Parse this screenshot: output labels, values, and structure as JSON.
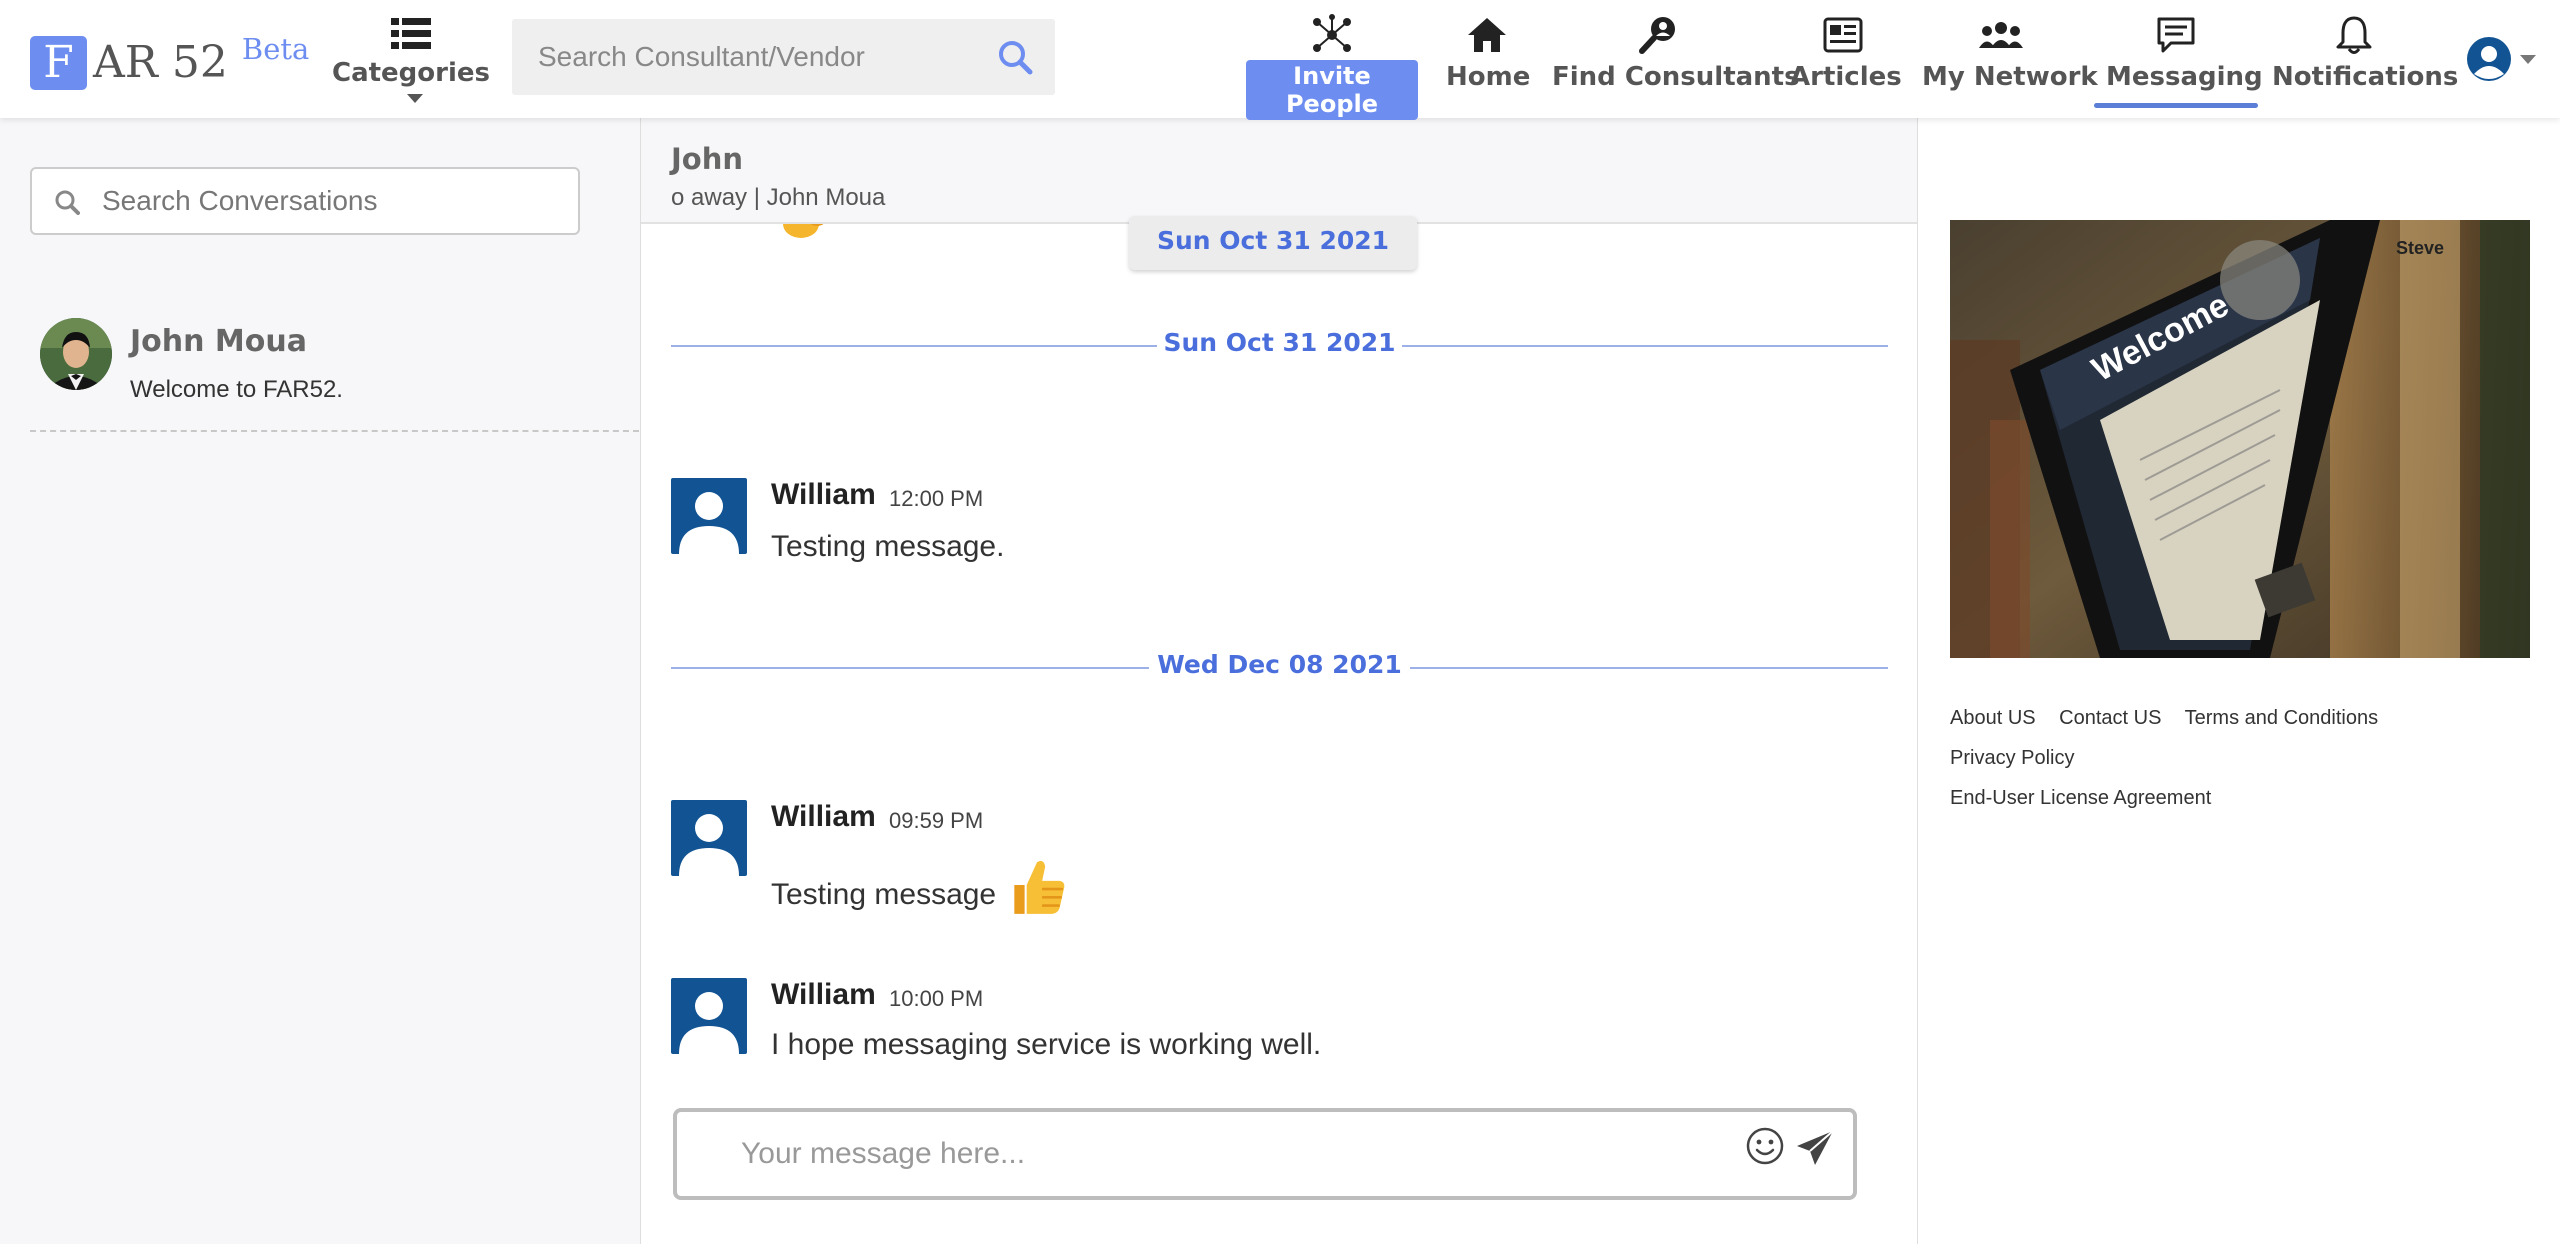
{
  "brand": {
    "logo_letter": "F",
    "logo_text": "AR 52",
    "beta": "Beta",
    "accent": "#6d8df0"
  },
  "nav": {
    "categories_label": "Categories",
    "search_placeholder": "Search Consultant/Vendor",
    "invite_label": "Invite People",
    "home_label": "Home",
    "find_label": "Find Consultants",
    "articles_label": "Articles",
    "network_label": "My Network",
    "messaging_label": "Messaging",
    "notifications_label": "Notifications",
    "active": "Messaging"
  },
  "sidebar": {
    "search_placeholder": "Search Conversations",
    "conversations": [
      {
        "name": "John Moua",
        "preview": "Welcome to FAR52."
      }
    ]
  },
  "chat": {
    "title": "John",
    "subtitle": "o away | John Moua",
    "sticky_date": "Sun Oct 31 2021",
    "date_separators": [
      "Sun Oct 31 2021",
      "Wed Dec 08 2021"
    ],
    "messages": [
      {
        "author": "William",
        "time": "12:00 PM",
        "text": "Testing message."
      },
      {
        "author": "William",
        "time": "09:59 PM",
        "text": "Testing message",
        "emoji": "thumbs-up"
      },
      {
        "author": "William",
        "time": "10:00 PM",
        "text": "I hope messaging service is working well."
      }
    ],
    "compose_placeholder": "Your message here..."
  },
  "right": {
    "ad_text": {
      "welcome": "Welcome",
      "name": "Steve"
    },
    "footer_links": [
      "About US",
      "Contact US",
      "Terms and Conditions",
      "Privacy Policy",
      "End-User License Agreement"
    ]
  },
  "colors": {
    "link_blue": "#4a6fdc",
    "avatar_blue": "#125493",
    "underline": "#5b7fd6"
  }
}
